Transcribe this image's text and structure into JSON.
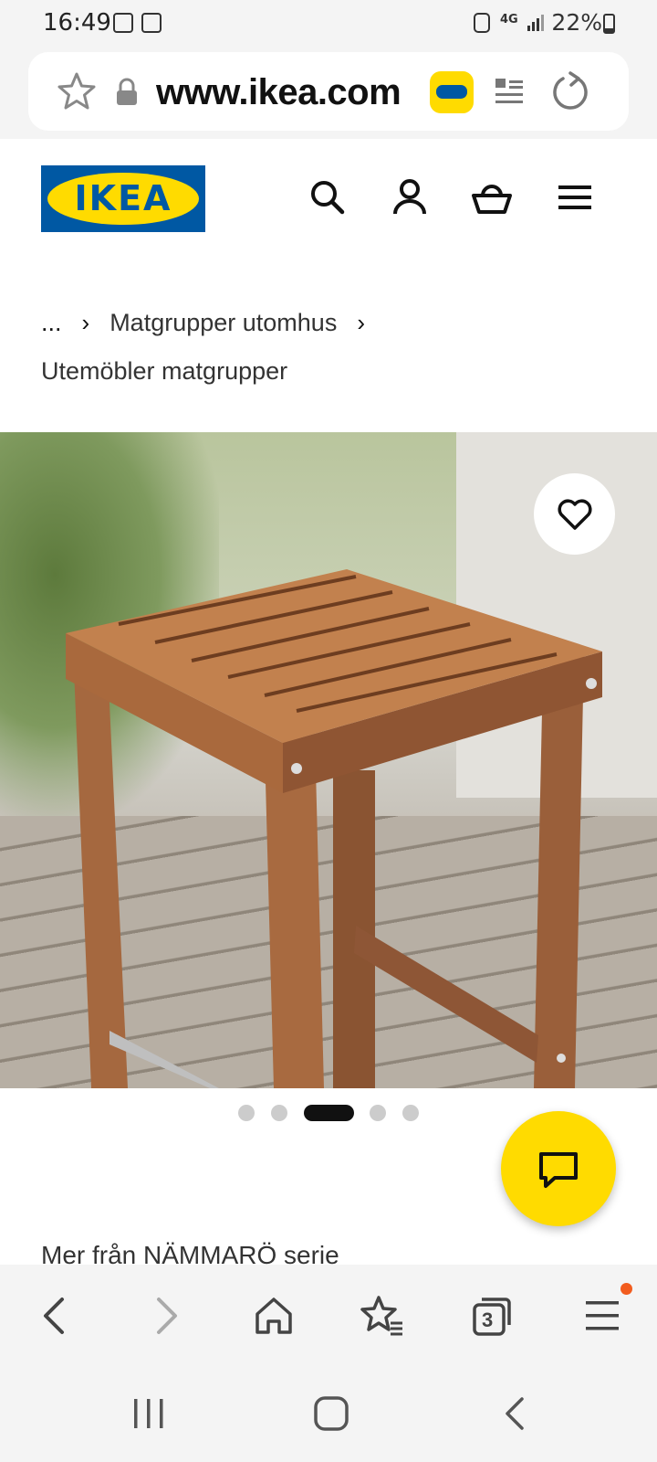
{
  "status_bar": {
    "time": "16:49",
    "network": "4G",
    "battery": "22%"
  },
  "browser": {
    "url": "www.ikea.com",
    "tab_count": "3"
  },
  "header": {
    "logo_text": "IKEA"
  },
  "breadcrumb": {
    "ellipsis": "...",
    "items": [
      "Matgrupper utomhus",
      "Utemöbler matgrupper"
    ]
  },
  "gallery": {
    "slide_count": 5,
    "active_index": 2
  },
  "section": {
    "more_from_series": "Mer från NÄMMARÖ serie"
  },
  "colors": {
    "ikea_blue": "#0058a3",
    "ikea_yellow": "#ffdb00",
    "notification": "#f25c1e"
  },
  "icons": [
    "star-icon",
    "lock-icon",
    "reader-mode-icon",
    "reload-icon",
    "search-icon",
    "account-icon",
    "basket-icon",
    "menu-icon",
    "heart-icon",
    "chat-icon",
    "back-icon",
    "forward-icon",
    "home-icon",
    "bookmarks-icon",
    "tabs-icon",
    "browser-menu-icon"
  ]
}
